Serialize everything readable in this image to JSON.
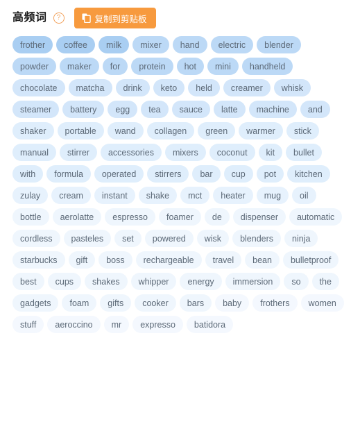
{
  "header": {
    "title": "高频词",
    "help_icon_label": "?",
    "copy_button_label": "复制到剪贴板"
  },
  "colors": {
    "accent_orange": "#f79a3e",
    "tag_text": "#5d6a78",
    "tag_level_1": "#a9cef2",
    "tag_level_2": "#bcd9f6",
    "tag_level_3": "#d3e6fa",
    "tag_level_4": "#dfeefc",
    "tag_level_5": "#e7f2fd",
    "tag_level_6": "#eff6fd",
    "tag_level_7": "#f4f8fe",
    "page_background": "#ffffff"
  },
  "tag_cloud": {
    "rows": [
      {
        "level": 1,
        "tags": [
          "frother",
          "coffee",
          "milk"
        ]
      },
      {
        "level": 2,
        "tags": [
          "mixer",
          "hand",
          "electric",
          "blender",
          "powder",
          "maker",
          "for",
          "protein",
          "hot",
          "mini",
          "handheld"
        ]
      },
      {
        "level": 3,
        "tags": [
          "chocolate",
          "matcha",
          "drink",
          "keto",
          "held",
          "creamer",
          "whisk",
          "steamer",
          "battery",
          "egg",
          "tea",
          "sauce",
          "latte",
          "machine",
          "and"
        ]
      },
      {
        "level": 4,
        "tags": [
          "shaker",
          "portable",
          "wand",
          "collagen",
          "green",
          "warmer",
          "stick",
          "manual",
          "stirrer",
          "accessories",
          "mixers",
          "coconut",
          "kit",
          "bullet",
          "with",
          "formula",
          "operated",
          "stirrers",
          "bar",
          "cup",
          "pot",
          "kitchen"
        ]
      },
      {
        "level": 5,
        "tags": [
          "zulay",
          "cream",
          "instant",
          "shake",
          "mct",
          "heater",
          "mug",
          "oil"
        ]
      },
      {
        "level": 6,
        "tags": [
          "bottle",
          "aerolatte",
          "espresso",
          "foamer",
          "de",
          "dispenser",
          "automatic",
          "cordless",
          "pasteles",
          "set",
          "powered",
          "wisk",
          "blenders",
          "ninja",
          "starbucks",
          "gift",
          "boss",
          "rechargeable",
          "travel",
          "bean",
          "bulletproof",
          "best",
          "cups",
          "shakes",
          "whipper",
          "energy",
          "immersion",
          "so",
          "the",
          "gadgets",
          "foam",
          "gifts",
          "cooker",
          "bars"
        ]
      },
      {
        "level": 7,
        "tags": [
          "baby",
          "frothers",
          "women",
          "stuff",
          "aeroccino",
          "mr",
          "expresso",
          "batidora"
        ]
      }
    ]
  }
}
